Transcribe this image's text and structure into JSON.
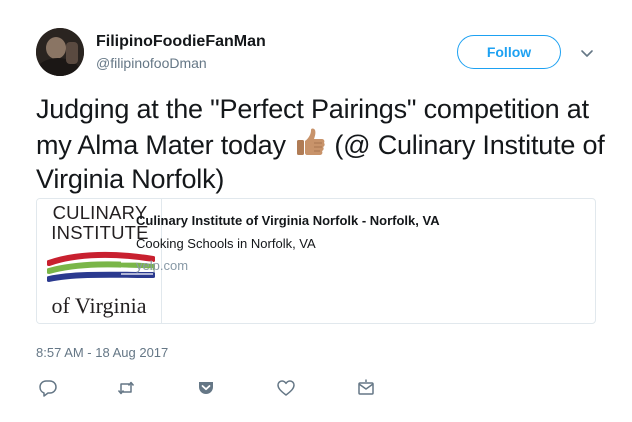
{
  "tweet": {
    "author": {
      "fullname": "FilipinoFoodieFanMan",
      "username": "@filipinofooDman"
    },
    "follow_label": "Follow",
    "text_before_emoji": "Judging at the \"Perfect Pairings\" competition at my Alma Mater today ",
    "emoji": "thumbs-up-medium-skin-tone",
    "text_after_emoji": " (@ Culinary Institute of Virginia Norfolk)",
    "card": {
      "logo_line1": "CULINARY",
      "logo_line2": "INSTITUTE",
      "logo_line3": "of Virginia",
      "title": "Culinary Institute of Virginia Norfolk - Norfolk, VA",
      "description": "Cooking Schools in Norfolk, VA",
      "domain": "yelp.com"
    },
    "timestamp": "8:57 AM - 18 Aug 2017",
    "actions": [
      "reply-icon",
      "retweet-icon",
      "pocket-icon",
      "like-icon",
      "direct-message-icon"
    ]
  },
  "colors": {
    "accent": "#1da1f2",
    "secondary_text": "#657786",
    "border": "#e1e8ed",
    "logo_red": "#c8202f",
    "logo_green": "#7ab648",
    "logo_navy": "#2b3a8f"
  }
}
